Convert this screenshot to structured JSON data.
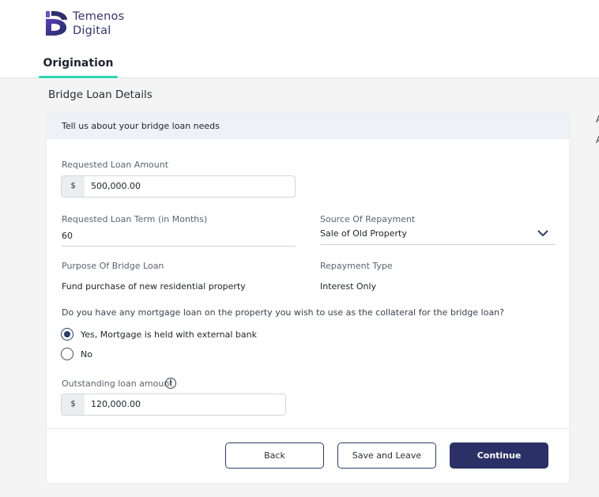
{
  "brand": {
    "line1": "Temenos",
    "line2": "Digital",
    "color": "#33376d"
  },
  "nav": {
    "tabs": [
      {
        "label": "Origination",
        "active": true
      }
    ],
    "active_underline_color": "#2ed5b4"
  },
  "page": {
    "title": "Bridge Loan Details",
    "edge_letters": [
      "A",
      "A"
    ]
  },
  "form": {
    "header": "Tell us about your bridge loan needs",
    "requested_amount": {
      "label": "Requested Loan Amount",
      "prefix": "$",
      "value": "500,000.00"
    },
    "term": {
      "label": "Requested Loan Term (in Months)",
      "value": "60"
    },
    "source_of_repayment": {
      "label": "Source Of Repayment",
      "value": "Sale of Old Property",
      "icon": "chevron-down-icon"
    },
    "purpose": {
      "label": "Purpose Of Bridge Loan",
      "value": "Fund purchase of new residential property"
    },
    "repayment_type": {
      "label": "Repayment Type",
      "value": "Interest Only"
    },
    "mortgage_question": {
      "question": "Do you have any mortgage loan on the property you wish to use as the collateral for the bridge loan?",
      "options": [
        {
          "label": "Yes, Mortgage is held with external bank",
          "selected": true
        },
        {
          "label": "No",
          "selected": false
        }
      ]
    },
    "outstanding_amount": {
      "label": "Outstanding loan amount",
      "info_icon": "info-icon",
      "info_glyph": "i",
      "prefix": "$",
      "value": "120,000.00"
    }
  },
  "actions": {
    "back": "Back",
    "save_leave": "Save and Leave",
    "continue": "Continue",
    "primary_color": "#2b3166"
  }
}
